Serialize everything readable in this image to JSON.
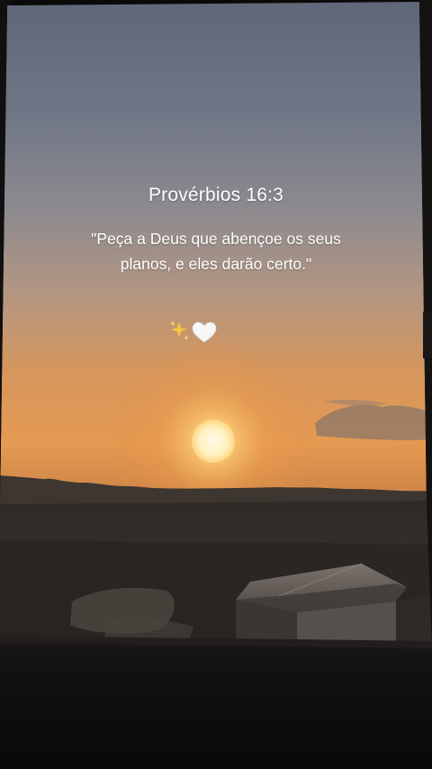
{
  "verse": {
    "reference": "Provérbios 16:3",
    "quote": "\"Peça a Deus que abençoe os seus planos, e eles darão certo.\""
  },
  "decorations": {
    "sparkles_icon": "sparkles-icon",
    "heart_icon": "white-heart-icon",
    "heart_color": "#f7f7f7",
    "sparkle_color": "#f5c542"
  },
  "scene": {
    "description_colors": {
      "sky_top": "#6b7283",
      "sky_mid": "#a9988c",
      "horizon": "#e8924a",
      "sun": "#fff4d6",
      "ground": "#2a2623",
      "frame": "#0b0a0a"
    }
  }
}
